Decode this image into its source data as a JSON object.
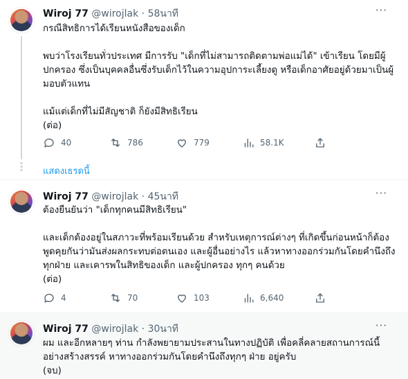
{
  "tweets": [
    {
      "name": "Wiroj 77",
      "handle": "@wirojlak",
      "time": "58นาที",
      "body": "กรณีสิทธิการได้เรียนหนังสือของเด็ก\n\nพบว่าโรงเรียนทั่วประเทศ มีการรับ \"เด็กที่ไม่สามารถติดตามพ่อแม่ได้\" เข้าเรียน โดยมีผู้ปกครอง ซึ่งเป็นบุคคลอื่นซึ่งรับเด็กไว้ในความอุปการะเลี้ยงดู หรือเด็กอาศัยอยู่ด้วยมาเป็นผู้มอบตัวแทน\n\nแม้แต่เด็กที่ไม่มีสัญชาติ ก็ยังมีสิทธิเรียน\n(ต่อ)",
      "replies": "40",
      "retweets": "786",
      "likes": "779",
      "views": "58.1K"
    },
    {
      "name": "Wiroj 77",
      "handle": "@wirojlak",
      "time": "45นาที",
      "body": "ต้องยืนยันว่า \"เด็กทุกคนมีสิทธิเรียน\"\n\nและเด็กต้องอยู่ในสภาวะที่พร้อมเรียนด้วย สำหรับเหตุการณ์ต่างๆ ที่เกิดขึ้นก่อนหน้าก็ต้องพูดคุยกันว่ามันส่งผลกระทบต่อตนเอง และผู้อื่นอย่างไร แล้วหาทางออกร่วมกันโดยคำนึงถึงทุกฝ่าย และเคารพในสิทธิของเด็ก และผู้ปกครอง ทุกๆ คนด้วย\n(ต่อ)",
      "replies": "4",
      "retweets": "70",
      "likes": "103",
      "views": "6,640"
    },
    {
      "name": "Wiroj 77",
      "handle": "@wirojlak",
      "time": "30นาที",
      "body": "ผม และอีกหลายๆ ท่าน กำลังพยายามประสานในทางปฏิบัติ เพื่อคลี่คลายสถานการณ์นี้อย่างสร้างสรรค์ หาทางออกร่วมกันโดยคำนึงถึงทุกๆ ฝ่าย อยู่ครับ\n(จบ)"
    }
  ],
  "show_thread": "แสดงเธรดนี้",
  "icons": [
    "more-icon",
    "reply-icon",
    "retweet-icon",
    "like-icon",
    "views-icon",
    "share-icon"
  ]
}
